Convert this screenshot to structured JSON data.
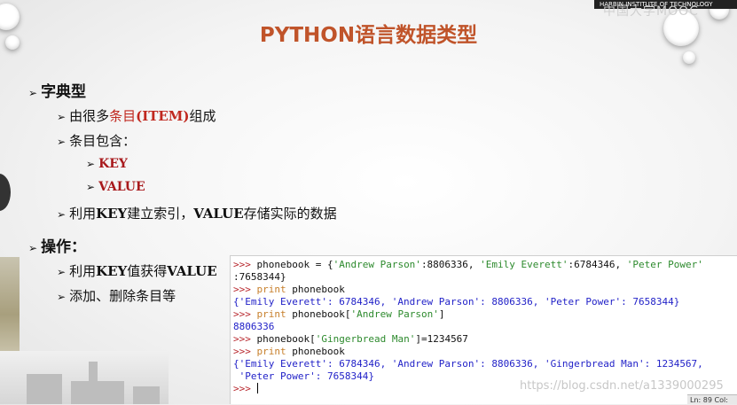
{
  "slide": {
    "title": "PYTHON语言数据类型",
    "logo_text": "HARBIN INSTITUTE OF TECHNOLOGY",
    "mooc_text": "中国大学MOOC",
    "bullets": {
      "dict": "字典型",
      "item_pre": "由很多",
      "item_red": "条目",
      "item_bold": "(ITEM)",
      "item_post": "组成",
      "contains": "条目包含：",
      "key": "KEY",
      "value": "VALUE",
      "index_pre": "利用",
      "index_key": "KEY",
      "index_mid": "建立索引，",
      "index_value": "VALUE",
      "index_post": "存储实际的数据",
      "ops": "操作：",
      "get_pre": "利用",
      "get_key": "KEY",
      "get_mid": "值获得",
      "get_value": "VALUE",
      "add_del": "添加、删除条目等"
    }
  },
  "shell": {
    "prompt": ">>> ",
    "l1_a": "phonebook = {",
    "l1_b": "'Andrew Parson'",
    "l1_c": ":8806336, ",
    "l1_d": "'Emily Everett'",
    "l1_e": ":6784346, ",
    "l1_f": "'Peter Power'",
    "l1_g": ":7658344}",
    "kw_print": "print",
    "print_arg": " phonebook",
    "out1": "{'Emily Everett': 6784346, 'Andrew Parson': 8806336, 'Peter Power': 7658344}",
    "l3_a": " phonebook[",
    "l3_b": "'Andrew Parson'",
    "l3_c": "]",
    "out2": "8806336",
    "l4_a": "phonebook[",
    "l4_b": "'Gingerbread Man'",
    "l4_c": "]=1234567",
    "out3a": "{'Emily Everett': 6784346, 'Andrew Parson': 8806336, 'Gingerbread Man': 1234567,",
    "out3b": " 'Peter Power': 7658344}",
    "status": "Ln: 89 Col:"
  },
  "watermark": "https://blog.csdn.net/a1339000295"
}
